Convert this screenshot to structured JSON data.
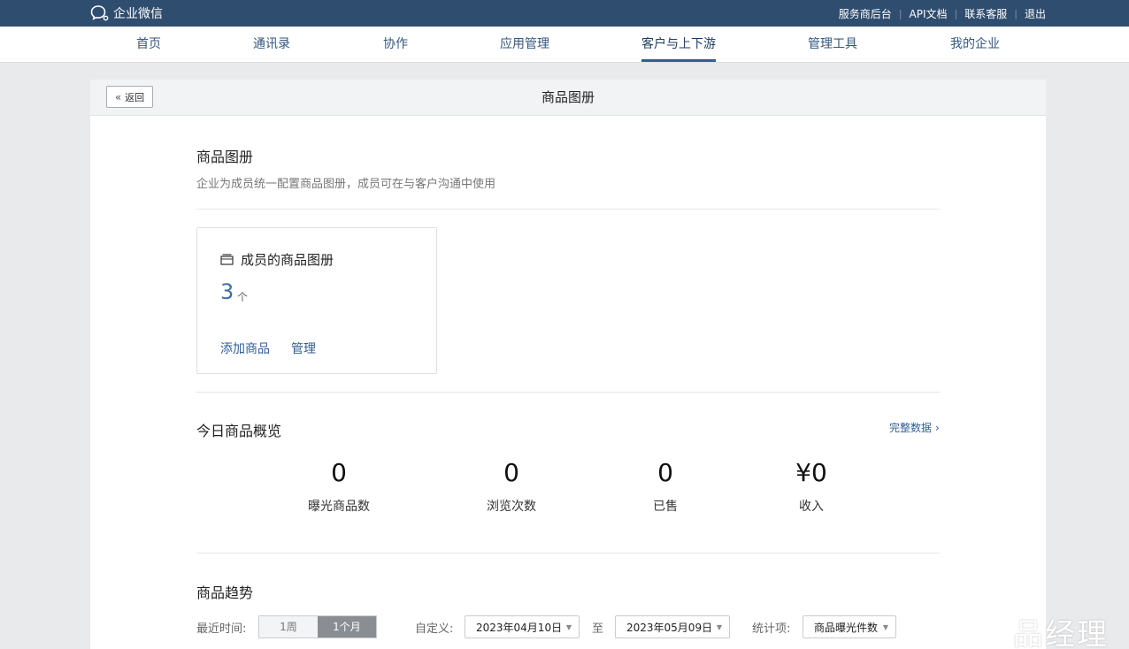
{
  "app": {
    "logo_text": "企业微信",
    "top_links": [
      "服务商后台",
      "API文档",
      "联系客服",
      "退出"
    ]
  },
  "nav": {
    "items": [
      "首页",
      "通讯录",
      "协作",
      "应用管理",
      "客户与上下游",
      "管理工具",
      "我的企业"
    ],
    "active": "客户与上下游"
  },
  "header": {
    "back_label": "返回",
    "title": "商品图册"
  },
  "intro": {
    "title": "商品图册",
    "desc": "企业为成员统一配置商品图册，成员可在与客户沟通中使用"
  },
  "album": {
    "title": "成员的商品图册",
    "count": "3",
    "unit": "个",
    "add_label": "添加商品",
    "manage_label": "管理"
  },
  "overview": {
    "title": "今日商品概览",
    "full_data_label": "完整数据",
    "stats": [
      {
        "value": "0",
        "label": "曝光商品数"
      },
      {
        "value": "0",
        "label": "浏览次数"
      },
      {
        "value": "0",
        "label": "已售"
      },
      {
        "value": "¥0",
        "label": "收入"
      }
    ]
  },
  "trend": {
    "title": "商品趋势",
    "recent_label": "最近时间:",
    "ranges": [
      "1周",
      "1个月"
    ],
    "active_range": "1个月",
    "custom_label": "自定义:",
    "start_date": "2023年04月10日",
    "to_label": "至",
    "end_date": "2023年05月09日",
    "metric_label": "统计项:",
    "metric_value": "商品曝光件数"
  },
  "watermark": "品经理",
  "colors": {
    "topbar": "#2f4d6f",
    "link": "#2f5f97",
    "accent_count": "#3b6fa8"
  }
}
